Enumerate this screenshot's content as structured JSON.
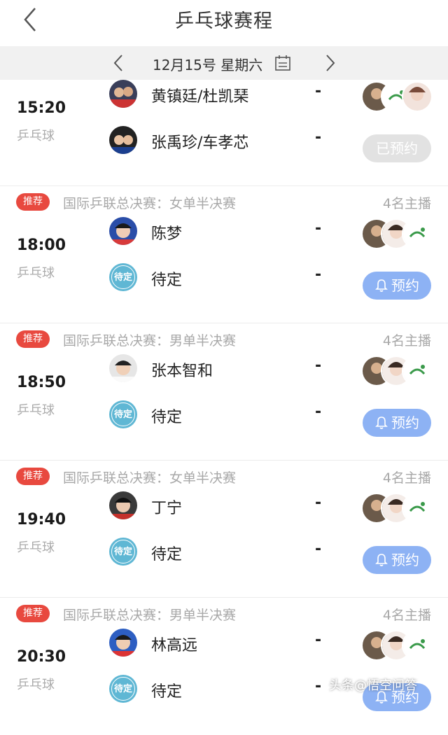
{
  "header": {
    "title": "乒乓球赛程"
  },
  "datebar": {
    "date": "12月15号 星期六"
  },
  "colors": {
    "badge": "#e8493f",
    "remind_button": "#8db2f4",
    "booked_button": "#e2e2e2"
  },
  "matches": [
    {
      "time": "15:20",
      "sport": "乒乓球",
      "players": [
        {
          "name": "黄镇廷/杜凯琹",
          "score": "-"
        },
        {
          "name": "张禹珍/车孝芯",
          "score": "-"
        }
      ],
      "button": "已预约"
    },
    {
      "badge": "推荐",
      "event": "国际乒联总决赛：女单半决赛",
      "hosts": "4名主播",
      "time": "18:00",
      "sport": "乒乓球",
      "players": [
        {
          "name": "陈梦",
          "score": "-"
        },
        {
          "name": "待定",
          "score": "-",
          "tbd_label": "待定"
        }
      ],
      "button": "预约"
    },
    {
      "badge": "推荐",
      "event": "国际乒联总决赛：男单半决赛",
      "hosts": "4名主播",
      "time": "18:50",
      "sport": "乒乓球",
      "players": [
        {
          "name": "张本智和",
          "score": "-"
        },
        {
          "name": "待定",
          "score": "-",
          "tbd_label": "待定"
        }
      ],
      "button": "预约"
    },
    {
      "badge": "推荐",
      "event": "国际乒联总决赛：女单半决赛",
      "hosts": "4名主播",
      "time": "19:40",
      "sport": "乒乓球",
      "players": [
        {
          "name": "丁宁",
          "score": "-"
        },
        {
          "name": "待定",
          "score": "-",
          "tbd_label": "待定"
        }
      ],
      "button": "预约"
    },
    {
      "badge": "推荐",
      "event": "国际乒联总决赛：男单半决赛",
      "hosts": "4名主播",
      "time": "20:30",
      "sport": "乒乓球",
      "players": [
        {
          "name": "林高远",
          "score": "-"
        },
        {
          "name": "待定",
          "score": "-",
          "tbd_label": "待定"
        }
      ],
      "button": "预约"
    }
  ],
  "watermark": "头条@悟空问答"
}
